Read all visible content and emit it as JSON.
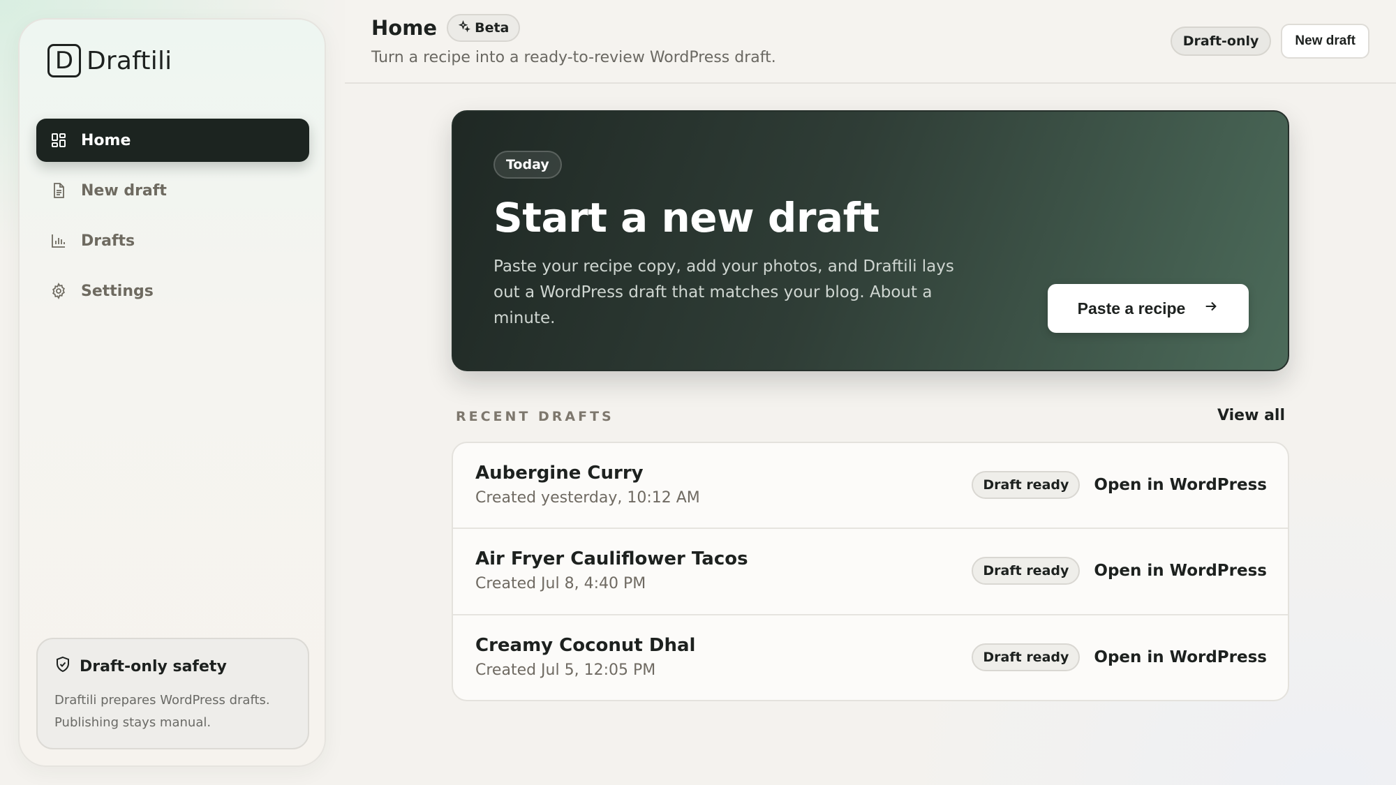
{
  "app": {
    "brand_letter": "D",
    "brand_name": "Draftili"
  },
  "sidebar": {
    "items": [
      {
        "label": "Home",
        "icon": "grid-icon",
        "active": true
      },
      {
        "label": "New draft",
        "icon": "document-icon",
        "active": false
      },
      {
        "label": "Drafts",
        "icon": "bar-chart-icon",
        "active": false
      },
      {
        "label": "Settings",
        "icon": "gear-icon",
        "active": false
      }
    ],
    "safety": {
      "title": "Draft-only safety",
      "text": "Draftili prepares WordPress drafts. Publishing stays manual."
    }
  },
  "header": {
    "title": "Home",
    "beta_label": "Beta",
    "subtitle": "Turn a recipe into a ready-to-review WordPress draft.",
    "mode_badge": "Draft-only",
    "new_draft_label": "New draft"
  },
  "hero": {
    "badge": "Today",
    "title": "Start a new draft",
    "text": "Paste your recipe copy, add your photos, and Draftili lays out a WordPress draft that matches your blog. About a minute.",
    "button_label": "Paste a recipe"
  },
  "recent": {
    "label": "RECENT DRAFTS",
    "view_all": "View all",
    "rows": [
      {
        "title": "Aubergine Curry",
        "meta": "Created yesterday, 10:12 AM",
        "status": "Draft ready",
        "action": "Open in WordPress"
      },
      {
        "title": "Air Fryer Cauliflower Tacos",
        "meta": "Created Jul 8, 4:40 PM",
        "status": "Draft ready",
        "action": "Open in WordPress"
      },
      {
        "title": "Creamy Coconut Dhal",
        "meta": "Created Jul 5, 12:05 PM",
        "status": "Draft ready",
        "action": "Open in WordPress"
      }
    ]
  },
  "colors": {
    "primary_dark": "#1c2420",
    "hero_gradient_start": "#1f2824",
    "hero_gradient_end": "#4c6b5a",
    "muted_text": "#6f6a62"
  }
}
